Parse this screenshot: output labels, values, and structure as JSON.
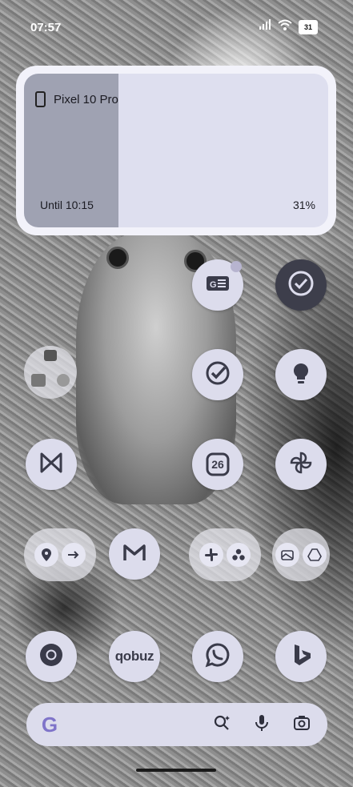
{
  "status_bar": {
    "time": "07:57",
    "battery": "31"
  },
  "battery_widget": {
    "device_name": "Pixel 10 Pro",
    "until_text": "Until 10:15",
    "percent_text": "31%",
    "level": 0.31
  },
  "apps": {
    "calendar_date": "26",
    "qobuz_label": "qobuz"
  },
  "icons": [
    "google-news-icon",
    "tasks-check-icon",
    "folder-news-icon",
    "tasks-icon",
    "lightbulb-icon",
    "bluesky-butterfly-icon",
    "calendar-icon",
    "pinwheel-icon",
    "maps-icon",
    "forward-icon",
    "gmail-icon",
    "slack-icon",
    "dots-icon",
    "gallery-icon",
    "drive-icon",
    "chrome-icon",
    "qobuz-icon",
    "whatsapp-icon",
    "bing-icon",
    "google-g-icon",
    "lens-search-icon",
    "microphone-icon",
    "camera-lens-icon"
  ],
  "colors": {
    "widget_bg": "#f2f2fa",
    "widget_fill": "#9fa2b2",
    "icon_bg": "#dcdcec",
    "icon_fg": "#3a3b4a"
  }
}
